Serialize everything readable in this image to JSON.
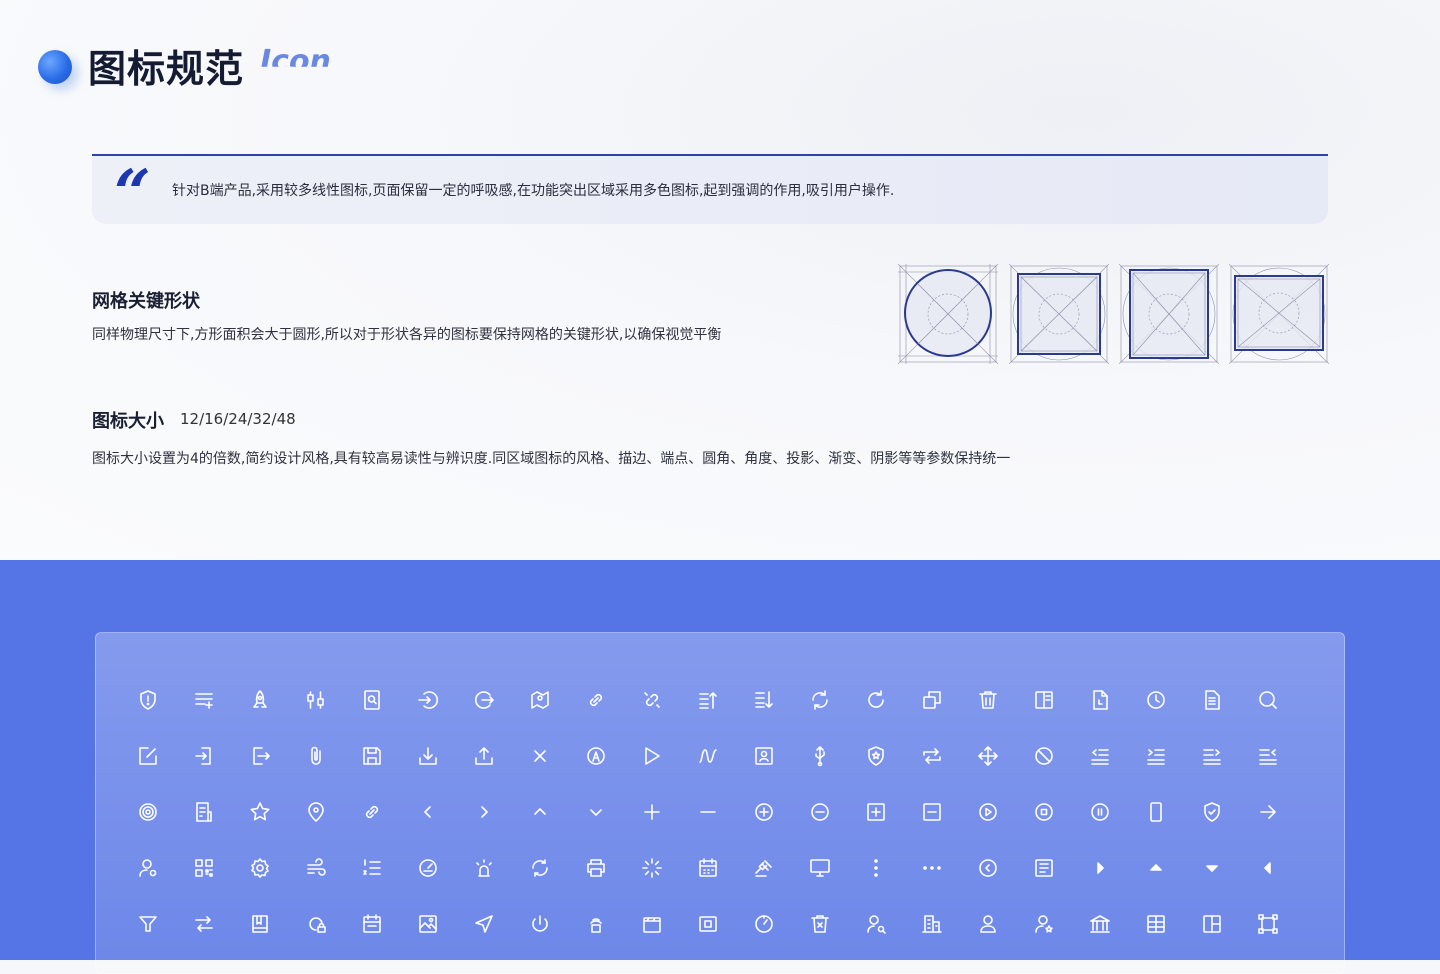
{
  "header": {
    "title": "图标规范",
    "title_en": "Icon"
  },
  "quote": {
    "mark": "“",
    "text": "针对B端产品,采用较多线性图标,页面保留一定的呼吸感,在功能突出区域采用多色图标,起到强调的作用,吸引用户操作."
  },
  "grid_section": {
    "title": "网格关键形状",
    "desc": "同样物理尺寸下,方形面积会大于圆形,所以对于形状各异的图标要保持网格的关键形状,以确保视觉平衡",
    "shapes": [
      "circle",
      "square",
      "square",
      "square"
    ]
  },
  "size_section": {
    "title": "图标大小",
    "sizes": "12/16/24/32/48",
    "desc": "图标大小设置为4的倍数,简约设计风格,具有较高易读性与辨识度.同区域图标的风格、描边、端点、圆角、角度、投影、渐变、阴影等等参数保持统一"
  },
  "colors": {
    "accent": "#1c37b0",
    "panel_bg": "#5574e6",
    "icon_stroke": "#ffffff"
  },
  "icon_rows": [
    [
      "shield-info-icon",
      "list-add-icon",
      "rocket-icon",
      "settings-sliders-icon",
      "document-search-icon",
      "login-circle-icon",
      "logout-circle-icon",
      "map-pin-icon",
      "link-icon",
      "link-break-icon",
      "sort-asc-icon",
      "sort-desc-icon",
      "refresh-icon",
      "reload-icon",
      "copy-icon",
      "trash-icon",
      "layout-icon",
      "file-icon",
      "clock-icon",
      "document-text-icon",
      "search-icon"
    ],
    [
      "edit-icon",
      "import-icon",
      "export-icon",
      "paperclip-icon",
      "save-icon",
      "download-icon",
      "upload-icon",
      "close-icon",
      "compass-icon",
      "play-icon",
      "route-icon",
      "contact-card-icon",
      "usb-icon",
      "shield-star-icon",
      "repeat-icon",
      "move-icon",
      "block-icon",
      "indent-left-icon",
      "outdent-left-icon",
      "indent-right-icon",
      "outdent-right-icon"
    ],
    [
      "target-icon",
      "document-list-icon",
      "star-icon",
      "location-icon",
      "link-circle-icon",
      "chevron-left-icon",
      "chevron-right-icon",
      "chevron-up-icon",
      "chevron-down-icon",
      "plus-icon",
      "minus-icon",
      "plus-circle-icon",
      "minus-circle-icon",
      "plus-square-icon",
      "minus-square-icon",
      "play-circle-icon",
      "stop-circle-icon",
      "pause-circle-icon",
      "phone-icon",
      "shield-check-icon",
      "arrow-right-icon"
    ],
    [
      "user-settings-icon",
      "qr-code-icon",
      "gear-icon",
      "wind-icon",
      "list-ordered-icon",
      "speedometer-icon",
      "alarm-icon",
      "sync-icon",
      "printer-icon",
      "loading-icon",
      "calendar-icon",
      "auction-icon",
      "monitor-icon",
      "more-vertical-icon",
      "more-horizontal-icon",
      "back-circle-icon",
      "news-icon",
      "caret-right-icon",
      "caret-up-icon",
      "caret-down-icon",
      "caret-left-icon"
    ],
    [
      "filter-icon",
      "swap-icon",
      "book-icon",
      "lock-circle-icon",
      "calendar-check-icon",
      "image-add-icon",
      "send-icon",
      "power-icon",
      "router-icon",
      "clapboard-icon",
      "scan-icon",
      "gauge-icon",
      "delete-bin-icon",
      "user-search-icon",
      "building-icon",
      "user-icon",
      "user-star-icon",
      "bank-icon",
      "table-icon",
      "layout-grid-icon",
      "crop-frame-icon"
    ]
  ]
}
